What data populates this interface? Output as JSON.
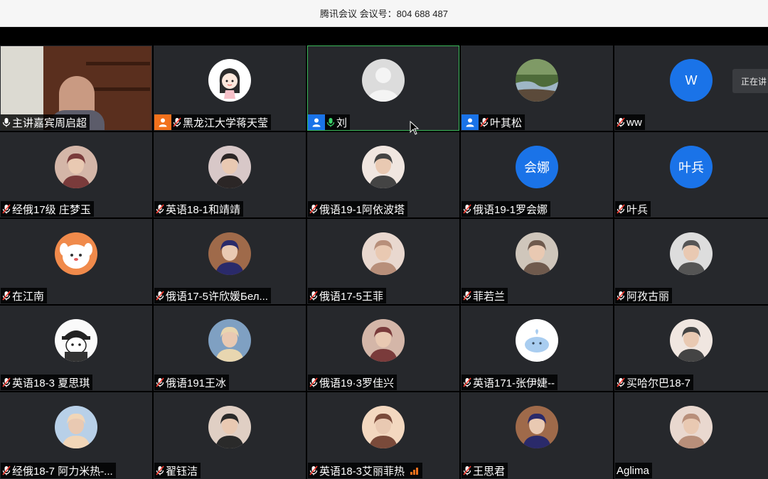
{
  "window": {
    "title": "腾讯会议 会议号：804 688 487"
  },
  "tooltip": {
    "text": "正在讲"
  },
  "colors": {
    "active_border": "#3bb85a",
    "avatar_blue": "#1a73e8",
    "host_orange": "#f2711c",
    "tile_bg": "#26282c"
  },
  "participants": [
    {
      "name": "主讲嘉宾周启超",
      "mic": "on",
      "role": "",
      "avatar": "video"
    },
    {
      "name": "黑龙江大学蒋天莹",
      "mic": "muted",
      "role": "host",
      "avatar": "cartoon-girl-icon"
    },
    {
      "name": "刘",
      "mic": "speaking",
      "role": "cohost",
      "avatar": "default-person-icon",
      "active": true
    },
    {
      "name": "叶其松",
      "mic": "muted",
      "role": "cohost",
      "avatar": "landscape-photo"
    },
    {
      "name": "ww",
      "mic": "muted",
      "role": "",
      "avatar_letter": "W"
    },
    {
      "name": "经俄17级 庄梦玉",
      "mic": "muted",
      "role": "",
      "avatar": "photo"
    },
    {
      "name": "英语18-1和靖靖",
      "mic": "muted",
      "role": "",
      "avatar": "photo"
    },
    {
      "name": "俄语19-1阿依波塔",
      "mic": "muted",
      "role": "",
      "avatar": "photo"
    },
    {
      "name": "俄语19-1罗会娜",
      "mic": "muted",
      "role": "",
      "avatar_letter": "会娜"
    },
    {
      "name": "叶兵",
      "mic": "muted",
      "role": "",
      "avatar_letter": "叶兵"
    },
    {
      "name": "在江南",
      "mic": "muted",
      "role": "",
      "avatar": "cartoon-dog-icon"
    },
    {
      "name": "俄语17-5许欣媛Бел...",
      "mic": "muted",
      "role": "",
      "avatar": "photo"
    },
    {
      "name": "俄语17-5王菲",
      "mic": "muted",
      "role": "",
      "avatar": "anime-photo"
    },
    {
      "name": "菲若兰",
      "mic": "muted",
      "role": "",
      "avatar": "photo"
    },
    {
      "name": "阿孜古丽",
      "mic": "muted",
      "role": "",
      "avatar": "photo"
    },
    {
      "name": "英语18-3 夏思琪",
      "mic": "muted",
      "role": "",
      "avatar": "cartoon-cap-icon"
    },
    {
      "name": "俄语191王冰",
      "mic": "muted",
      "role": "",
      "avatar": "photo"
    },
    {
      "name": "俄语19·3罗佳兴",
      "mic": "muted",
      "role": "",
      "avatar": "photo"
    },
    {
      "name": "英语171-张伊婕--",
      "mic": "muted",
      "role": "",
      "avatar": "cartoon-whale-icon"
    },
    {
      "name": "买哈尔巴18-7",
      "mic": "muted",
      "role": "",
      "avatar": "photo"
    },
    {
      "name": " 经俄18-7 阿力米热-...",
      "mic": "muted",
      "role": "",
      "avatar": "photo"
    },
    {
      "name": "翟钰洁",
      "mic": "muted",
      "role": "",
      "avatar": "photo"
    },
    {
      "name": "英语18-3艾丽菲热",
      "mic": "muted",
      "role": "",
      "avatar": "photo",
      "signal_bars": true
    },
    {
      "name": "王思君",
      "mic": "muted",
      "role": "",
      "avatar": "anime-photo"
    },
    {
      "name": "Aglima",
      "mic": "none",
      "role": "",
      "avatar": "photo"
    }
  ]
}
